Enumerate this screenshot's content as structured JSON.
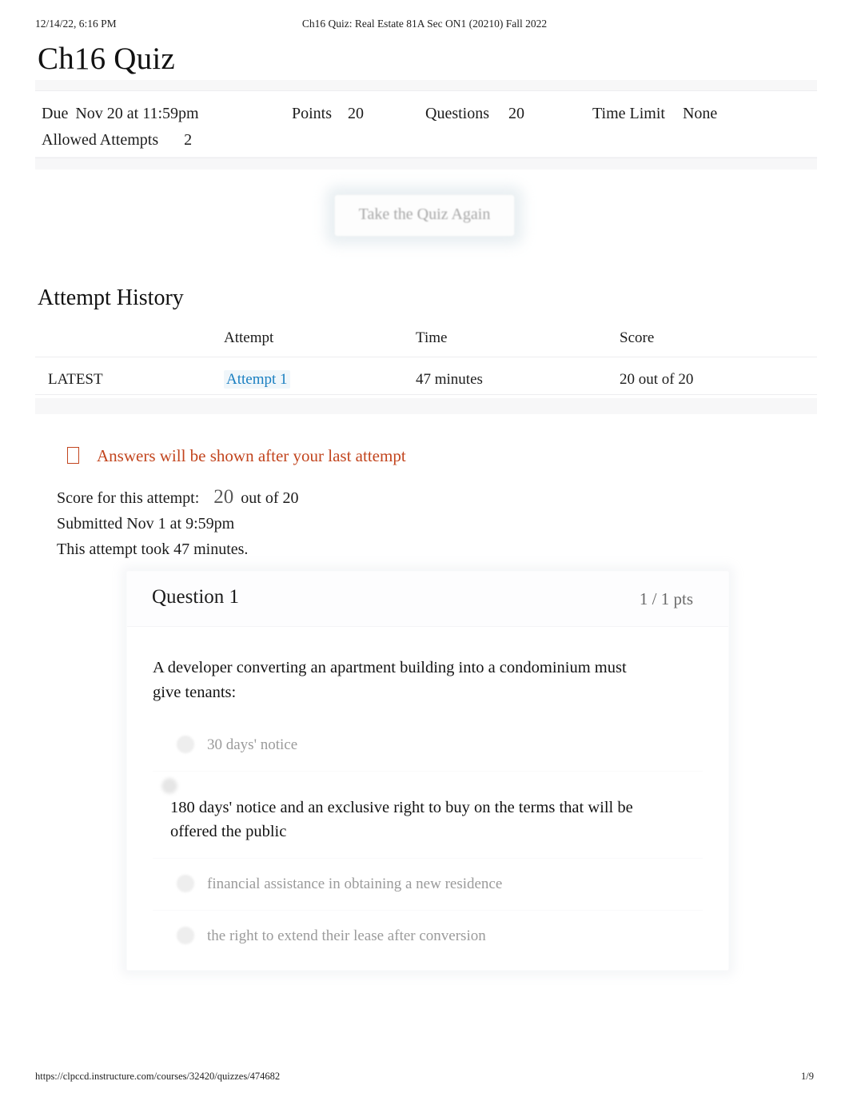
{
  "print_header": {
    "date": "12/14/22, 6:16 PM",
    "doc_title": "Ch16 Quiz: Real Estate 81A Sec ON1 (20210) Fall 2022"
  },
  "print_footer": {
    "url": "https://clpccd.instructure.com/courses/32420/quizzes/474682",
    "page": "1/9"
  },
  "page": {
    "title": "Ch16 Quiz"
  },
  "quiz_details": {
    "due_label": "Due",
    "due_value": "Nov 20 at 11:59pm",
    "points_label": "Points",
    "points_value": "20",
    "questions_label": "Questions",
    "questions_value": "20",
    "time_limit_label": "Time Limit",
    "time_limit_value": "None",
    "allowed_attempts_label": "Allowed Attempts",
    "allowed_attempts_value": "2"
  },
  "retake": {
    "label": "Take the Quiz Again"
  },
  "attempt_history": {
    "heading": "Attempt History",
    "columns": [
      "",
      "Attempt",
      "Time",
      "Score"
    ],
    "rows": [
      {
        "kept": "LATEST",
        "attempt": "Attempt 1",
        "time": "47 minutes",
        "score": "20 out of 20"
      }
    ]
  },
  "notice": {
    "icon": "warning-icon",
    "text": "Answers will be shown after your last attempt",
    "color": "#c2451e"
  },
  "score_summary": {
    "score_label": "Score for this attempt:",
    "score_value": "20",
    "score_suffix": "out of 20",
    "submitted": "Submitted Nov 1 at 9:59pm",
    "duration": "This attempt took 47 minutes."
  },
  "question": {
    "name": "Question 1",
    "points": "1 / 1 pts",
    "text": "A developer converting an apartment building into a condominium must give tenants:",
    "answers": [
      {
        "text": "30 days' notice",
        "selected": false
      },
      {
        "text": "180 days' notice and an exclusive right to buy on the terms that will be offered the public",
        "selected": true
      },
      {
        "text": "financial assistance in obtaining a new residence",
        "selected": false
      },
      {
        "text": "the right to extend their lease after conversion",
        "selected": false
      }
    ]
  },
  "colors": {
    "link": "#1a7fc1",
    "notice": "#c2451e",
    "text": "#1c1c1c",
    "muted": "#9b9b9b"
  }
}
